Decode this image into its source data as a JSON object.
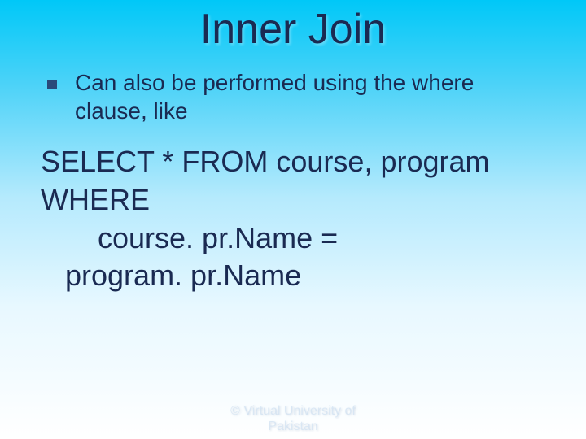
{
  "title": "Inner Join",
  "bullet": {
    "text": "Can also be performed using the where clause, like"
  },
  "sql": {
    "line1": "SELECT * FROM course, program",
    "line2": "WHERE",
    "line3": "course. pr.Name =",
    "line4": "program. pr.Name"
  },
  "footer": {
    "line1": "© Virtual University of",
    "line2": "Pakistan"
  }
}
